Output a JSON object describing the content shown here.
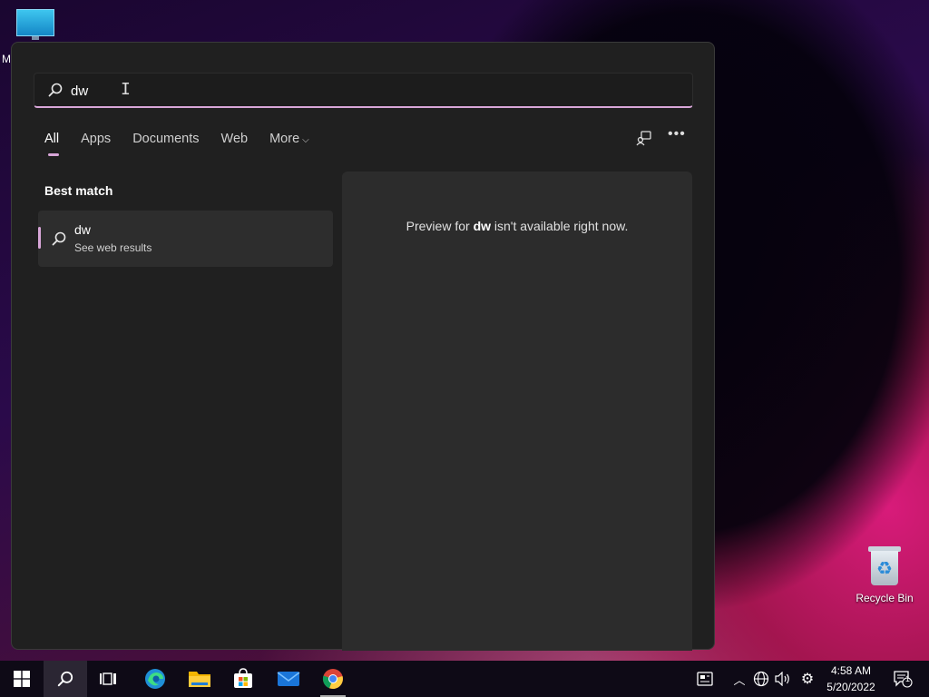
{
  "desktop": {
    "monitor_label": "M",
    "recycle_bin_label": "Recycle Bin"
  },
  "search": {
    "query": "dw",
    "icon": "search-icon"
  },
  "tabs": [
    {
      "label": "All"
    },
    {
      "label": "Apps"
    },
    {
      "label": "Documents"
    },
    {
      "label": "Web"
    },
    {
      "label": "More"
    }
  ],
  "best_match": {
    "heading": "Best match",
    "title": "dw",
    "subtitle": "See web results"
  },
  "preview": {
    "prefix": "Preview for ",
    "term": "dw",
    "suffix": " isn't available right now."
  },
  "taskbar": {
    "apps": [
      "windows-start-icon",
      "search-icon",
      "task-view-icon",
      "edge-icon",
      "file-explorer-icon",
      "store-icon",
      "mail-icon",
      "chrome-icon"
    ],
    "tray_icons": [
      "news-icon",
      "chevron-up-icon",
      "network-icon",
      "volume-icon",
      "settings-icon",
      "notification-icon"
    ],
    "time": "4:58 AM",
    "date": "5/20/2022",
    "notification_count": "1"
  },
  "colors": {
    "accent": "#d8a6d8",
    "panel_bg": "#202020",
    "preview_bg": "#2c2c2c"
  }
}
